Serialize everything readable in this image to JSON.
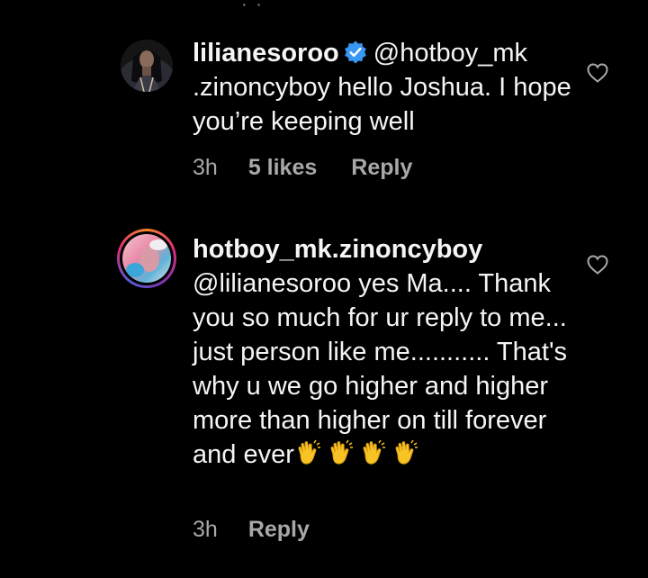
{
  "top_indicator": "· ·",
  "comments": [
    {
      "username": "lilianesoroo",
      "verified": true,
      "mention": "@hotboy_mk.zinoncyboy",
      "mention_line1": "@hotboy_mk",
      "mention_line2": ".zinoncyboy",
      "text": " hello Joshua. I hope you’re keeping well",
      "time": "3h",
      "likes": "5 likes",
      "reply_label": "Reply"
    },
    {
      "username": "hotboy_mk.zinoncyboy",
      "verified": false,
      "mention": "@lilianesoroo",
      "text": "  yes Ma.... Thank you so much for ur reply to me... just person like me........... That's why u we go higher and higher more than higher on till forever and ever",
      "emoji": [
        "clapping-hands",
        "clapping-hands",
        "clapping-hands",
        "clapping-hands"
      ],
      "time": "3h",
      "reply_label": "Reply"
    }
  ],
  "colors": {
    "background": "#000000",
    "text": "#f5f5f5",
    "meta_text": "#a8a8a8",
    "verified_badge": "#3897f0",
    "story_ring": [
      "#f58529",
      "#dd2a7b",
      "#8134af",
      "#515bd4"
    ]
  }
}
